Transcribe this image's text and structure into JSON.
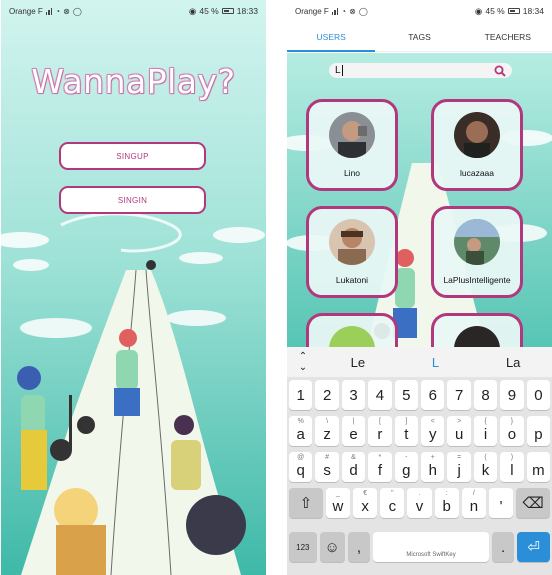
{
  "left": {
    "status": {
      "carrier": "Orange F",
      "battery": "45 %",
      "time": "18:33"
    },
    "title": "WannaPlay?",
    "buttons": {
      "signup": "SINGUP",
      "signin": "SINGIN"
    }
  },
  "right": {
    "status": {
      "carrier": "Orange F",
      "battery": "45 %",
      "time": "18:34"
    },
    "tabs": [
      {
        "label": "USERS",
        "active": true
      },
      {
        "label": "TAGS",
        "active": false
      },
      {
        "label": "TEACHERS",
        "active": false
      }
    ],
    "search": {
      "value": "L",
      "icon": "search-icon"
    },
    "users": [
      {
        "name": "Lino"
      },
      {
        "name": "lucazaaa"
      },
      {
        "name": "Lukatoni"
      },
      {
        "name": "LaPlusIntelligente"
      }
    ],
    "suggestions": [
      "Le",
      "L",
      "La"
    ],
    "keyboard": {
      "numbers": [
        "1",
        "2",
        "3",
        "4",
        "5",
        "6",
        "7",
        "8",
        "9",
        "0"
      ],
      "row1": [
        [
          "%",
          "a"
        ],
        [
          "\\",
          "z"
        ],
        [
          "|",
          "e"
        ],
        [
          "[",
          "r"
        ],
        [
          "]",
          "t"
        ],
        [
          "<",
          "y"
        ],
        [
          ">",
          "u"
        ],
        [
          "{",
          "i"
        ],
        [
          "}",
          "o"
        ],
        [
          "",
          "p"
        ]
      ],
      "row2": [
        [
          "@",
          "q"
        ],
        [
          "#",
          "s"
        ],
        [
          "&",
          "d"
        ],
        [
          "*",
          "f"
        ],
        [
          "-",
          "g"
        ],
        [
          "+",
          "h"
        ],
        [
          "=",
          "j"
        ],
        [
          "(",
          "k"
        ],
        [
          ")",
          "l"
        ],
        [
          "",
          "m"
        ]
      ],
      "row3": [
        [
          "_",
          "w"
        ],
        [
          "€",
          "x"
        ],
        [
          "\"",
          "c"
        ],
        [
          ".",
          "v"
        ],
        [
          ":",
          "b"
        ],
        [
          "/",
          "n"
        ],
        [
          "",
          "'"
        ]
      ],
      "shift": "⇧",
      "backspace": "⌫",
      "symbols": "123",
      "emoji": "☺",
      "comma": ",",
      "space_label": "Microsoft SwiftKey",
      "period": ".",
      "enter": "⏎"
    },
    "colors": {
      "accent": "#2a8fd8",
      "card_border": "#b2387e"
    }
  }
}
